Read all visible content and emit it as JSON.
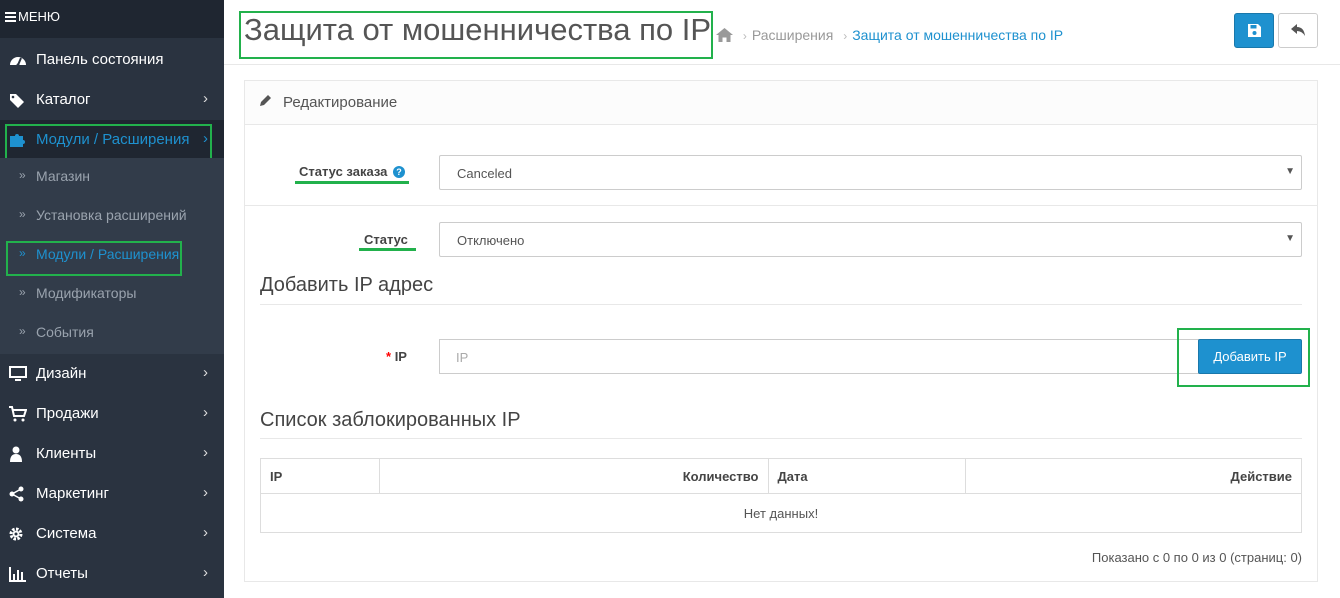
{
  "sidebar": {
    "menu_label": "МЕНЮ",
    "items": [
      {
        "label": "Панель состояния",
        "icon": "dashboard-icon"
      },
      {
        "label": "Каталог",
        "icon": "tags-icon"
      },
      {
        "label": "Модули / Расширения",
        "icon": "puzzle-icon",
        "active": true
      },
      {
        "label": "Дизайн",
        "icon": "monitor-icon"
      },
      {
        "label": "Продажи",
        "icon": "cart-icon"
      },
      {
        "label": "Клиенты",
        "icon": "user-icon"
      },
      {
        "label": "Маркетинг",
        "icon": "share-icon"
      },
      {
        "label": "Система",
        "icon": "gear-icon"
      },
      {
        "label": "Отчеты",
        "icon": "bar-chart-icon"
      }
    ],
    "subitems": [
      {
        "label": "Магазин"
      },
      {
        "label": "Установка расширений"
      },
      {
        "label": "Модули / Расширения",
        "active": true
      },
      {
        "label": "Модификаторы"
      },
      {
        "label": "События"
      }
    ]
  },
  "header": {
    "title": "Защита от мошенничества по IP",
    "breadcrumb": [
      "Расширения",
      "Защита от мошенничества по IP"
    ],
    "save_icon": "save-icon",
    "back_icon": "reply-icon"
  },
  "panel": {
    "title": "Редактирование",
    "order_status_label": "Статус заказа",
    "order_status_value": "Canceled",
    "status_label": "Статус",
    "status_value": "Отключено",
    "add_ip_heading": "Добавить IP адрес",
    "ip_label": "IP",
    "ip_required_mark": "*",
    "ip_placeholder": "IP",
    "add_ip_button": "Добавить IP",
    "blocked_heading": "Список заблокированных IP",
    "table_headers": [
      "IP",
      "Количество",
      "Дата",
      "Действие"
    ],
    "no_data": "Нет данных!",
    "pagination": "Показано с 0 по 0 из 0 (страниц: 0)"
  },
  "colors": {
    "accent": "#1e91cf",
    "sidebar_bg": "#2a3340",
    "highlight": "#22b14c"
  }
}
